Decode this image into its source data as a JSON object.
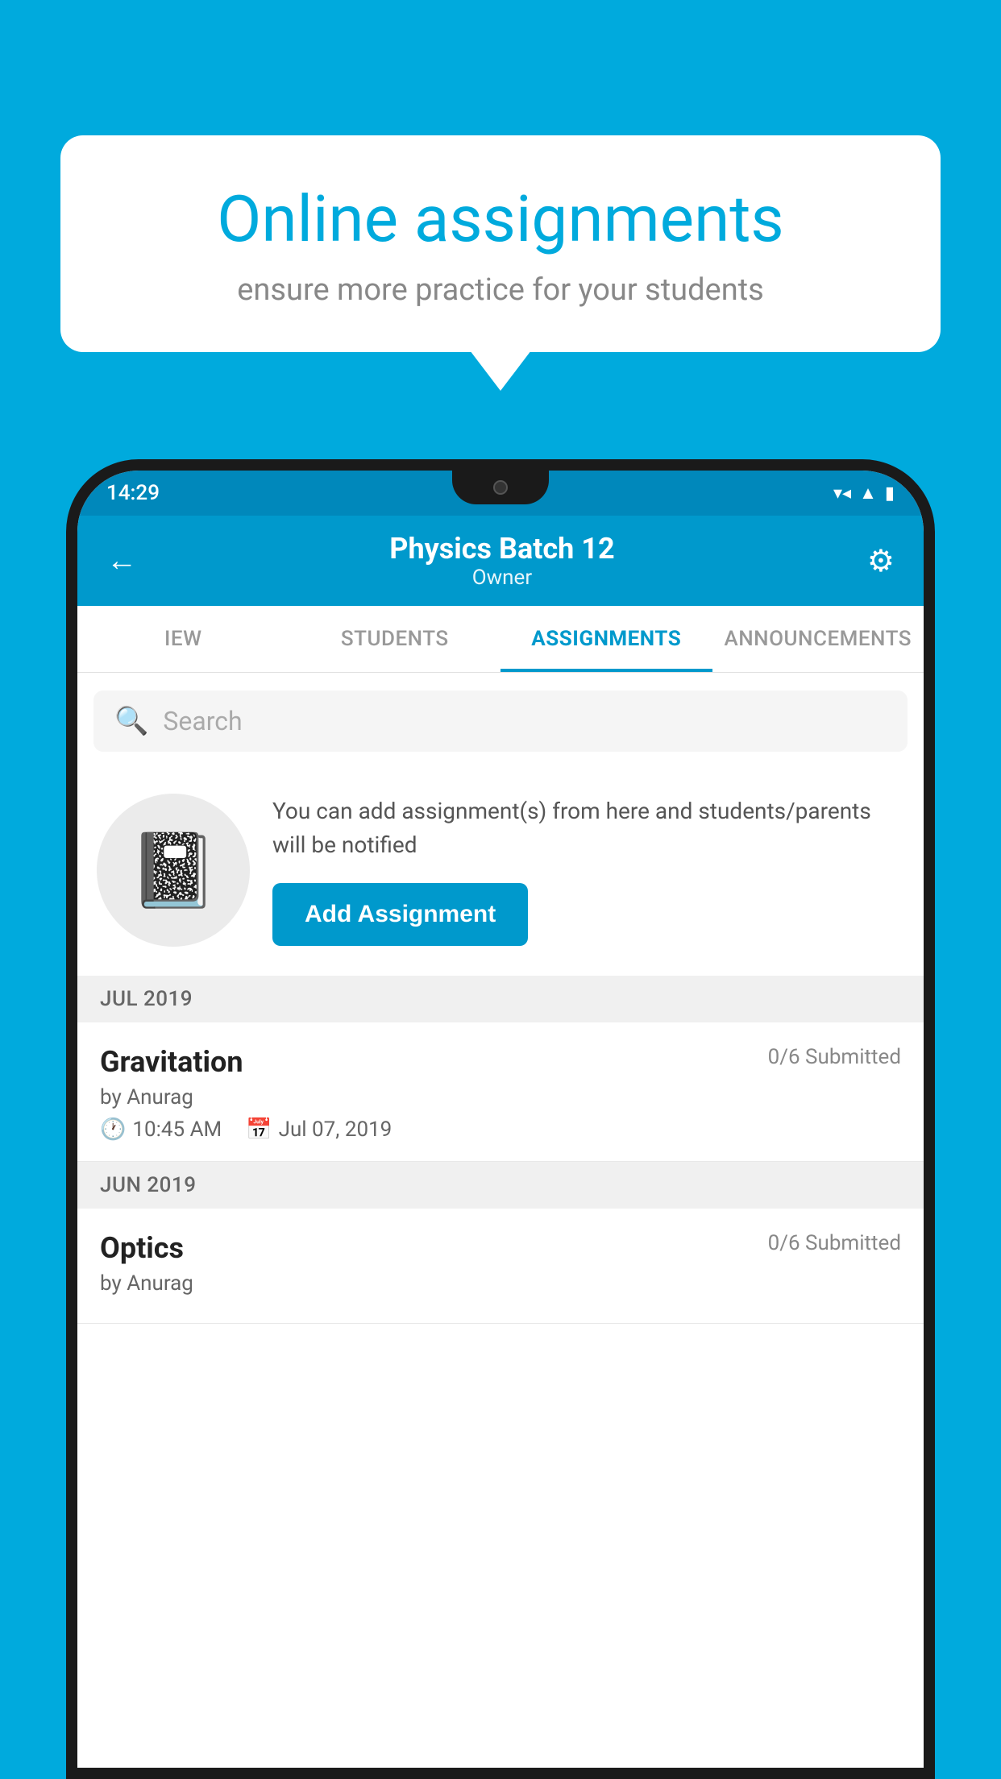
{
  "background_color": "#00AADD",
  "speech_bubble": {
    "title": "Online assignments",
    "subtitle": "ensure more practice for your students"
  },
  "status_bar": {
    "time": "14:29",
    "wifi": "▾",
    "signal": "▲",
    "battery": "▮"
  },
  "header": {
    "title": "Physics Batch 12",
    "subtitle": "Owner",
    "back_label": "←",
    "gear_label": "⚙"
  },
  "tabs": [
    {
      "label": "IEW",
      "active": false
    },
    {
      "label": "STUDENTS",
      "active": false
    },
    {
      "label": "ASSIGNMENTS",
      "active": true
    },
    {
      "label": "ANNOUNCEMENTS",
      "active": false
    }
  ],
  "search": {
    "placeholder": "Search"
  },
  "empty_state": {
    "description": "You can add assignment(s) from here and students/parents will be notified",
    "button_label": "Add Assignment",
    "icon": "📓"
  },
  "sections": [
    {
      "month": "JUL 2019",
      "assignments": [
        {
          "name": "Gravitation",
          "submitted": "0/6 Submitted",
          "author": "by Anurag",
          "time": "10:45 AM",
          "date": "Jul 07, 2019"
        }
      ]
    },
    {
      "month": "JUN 2019",
      "assignments": [
        {
          "name": "Optics",
          "submitted": "0/6 Submitted",
          "author": "by Anurag",
          "time": "",
          "date": ""
        }
      ]
    }
  ]
}
